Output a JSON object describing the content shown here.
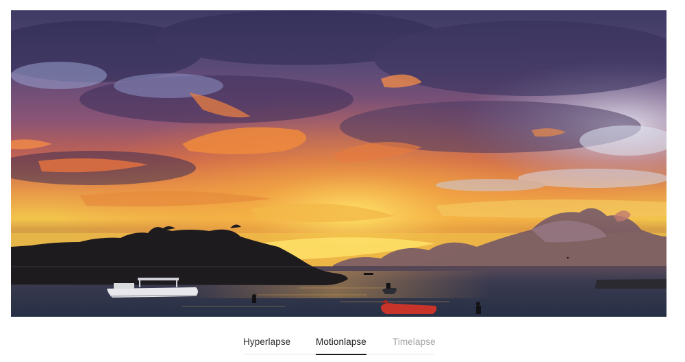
{
  "hero": {
    "scene": "sunset-over-bay",
    "colors": {
      "sky_top": "#3f3a66",
      "sky_mid": "#7a4f7a",
      "glow_orange": "#f08a3a",
      "glow_yellow": "#f6d24a",
      "water": "#2e3448",
      "silhouette": "#1f1c1f"
    }
  },
  "tabs": {
    "items": [
      {
        "label": "Hyperlapse",
        "state": "inactive",
        "color": "#2b2b2b"
      },
      {
        "label": "Motionlapse",
        "state": "active",
        "color": "#1a1a1a"
      },
      {
        "label": "Timelapse",
        "state": "disabled",
        "color": "#a3a3a3"
      }
    ]
  }
}
